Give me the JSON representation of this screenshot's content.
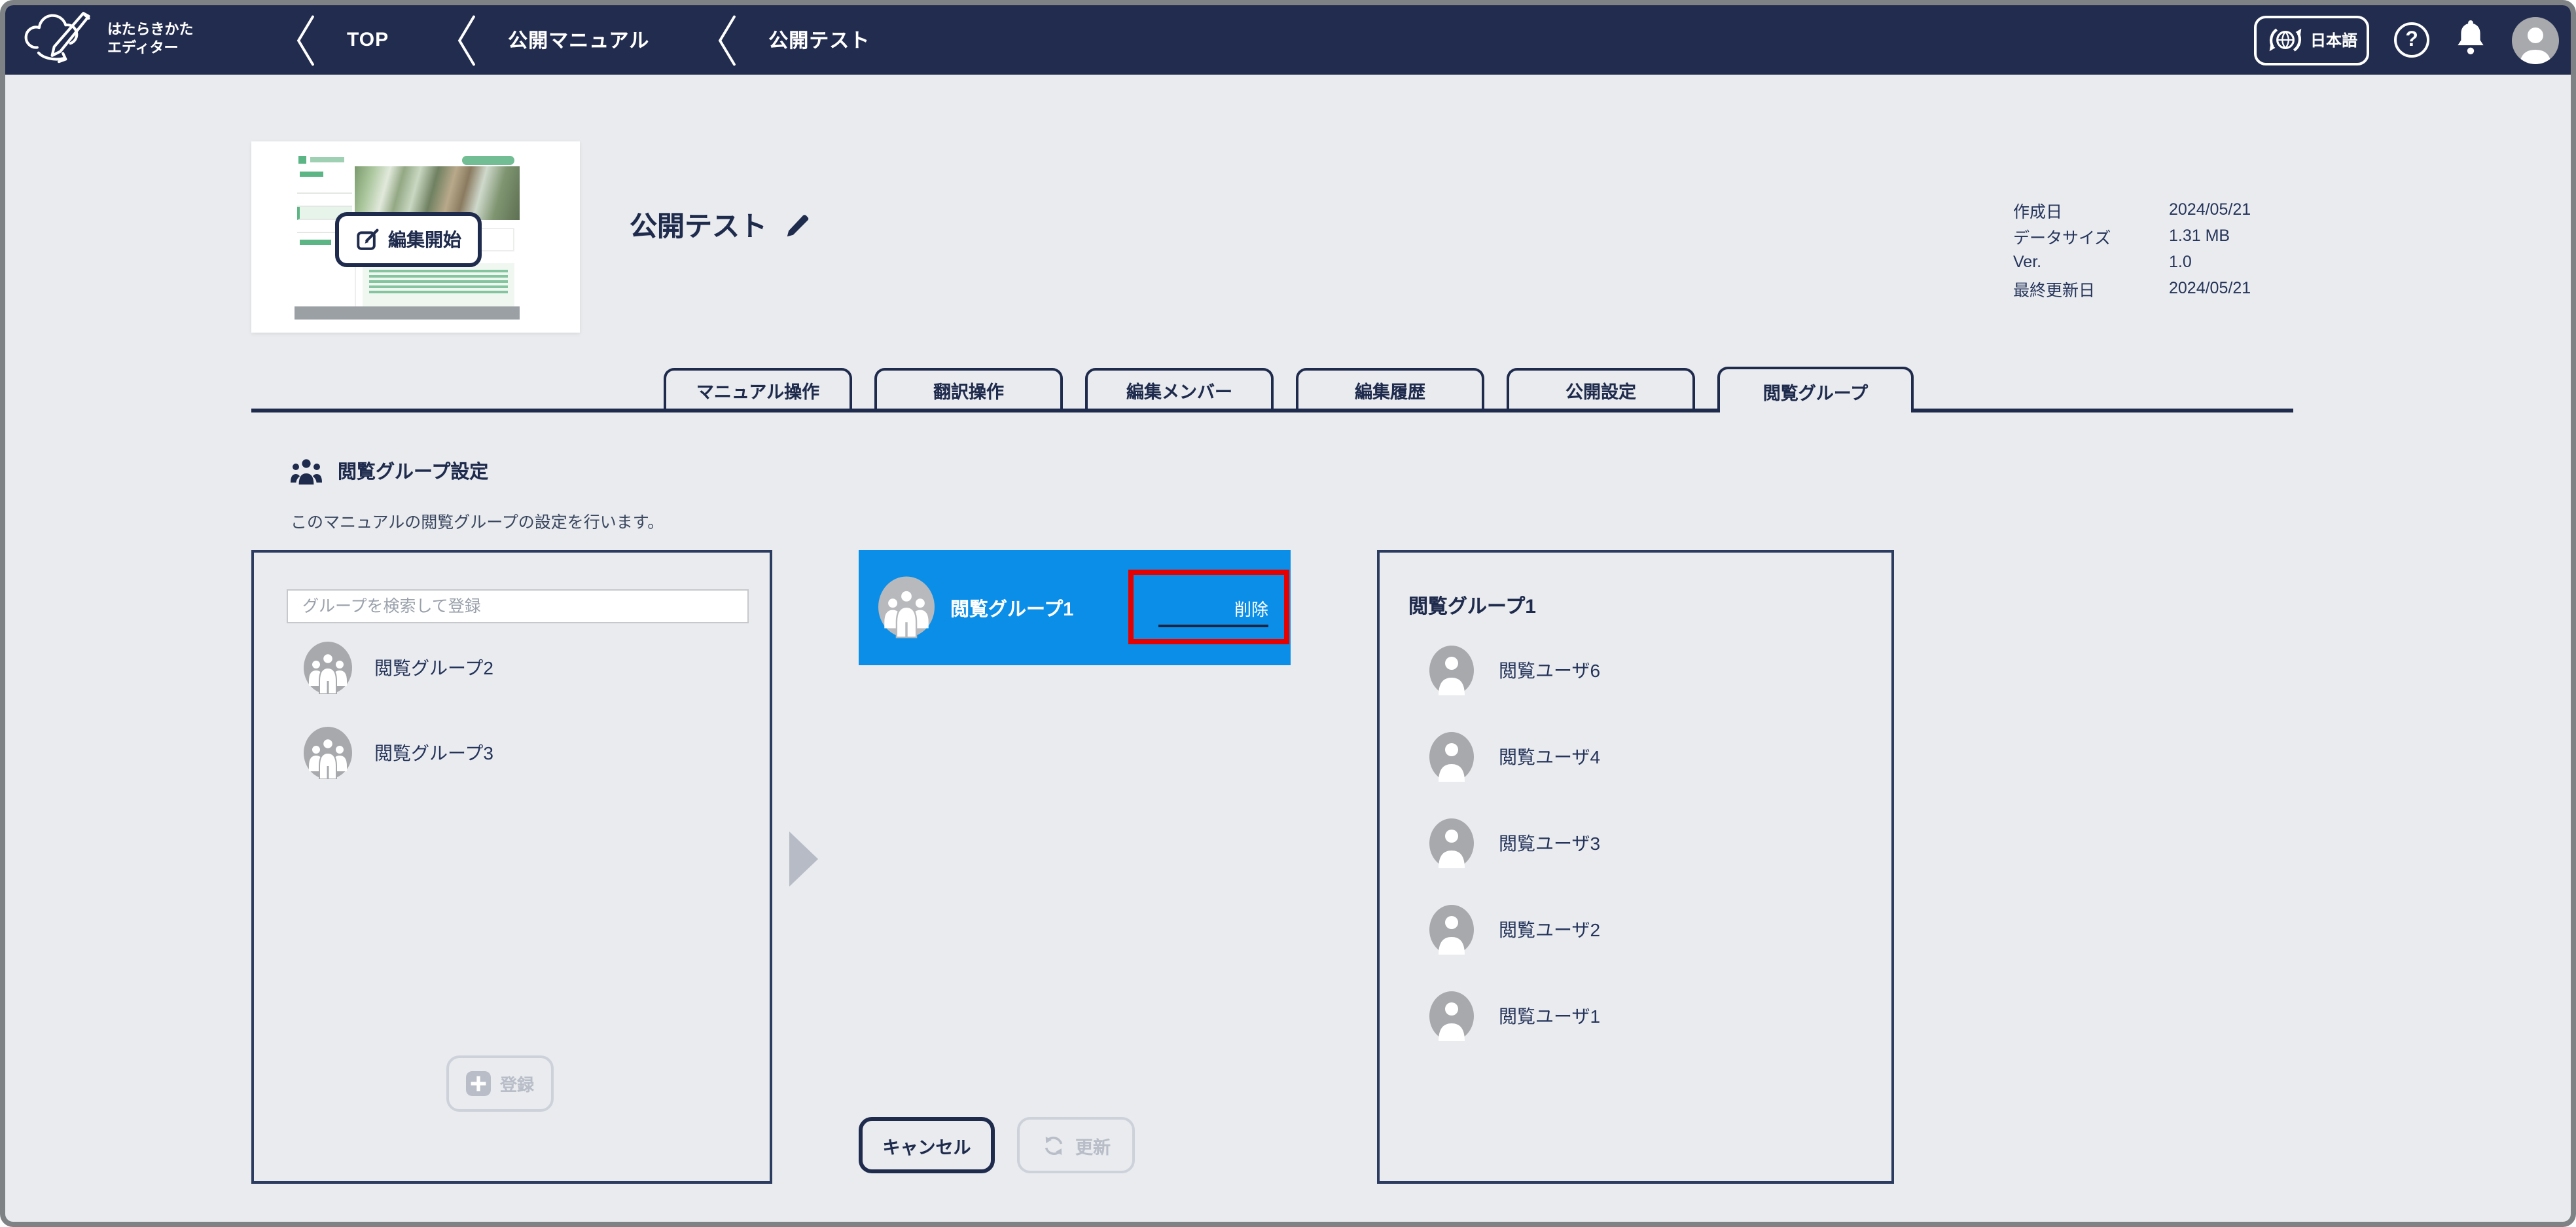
{
  "header": {
    "logo": {
      "line1": "はたらきかた",
      "line2": "エディター"
    },
    "breadcrumbs": [
      {
        "label": "TOP"
      },
      {
        "label": "公開マニュアル"
      },
      {
        "label": "公開テスト"
      }
    ],
    "language_button": {
      "label": "日本語"
    },
    "help_label": "?"
  },
  "manual": {
    "title": "公開テスト",
    "edit_start_label": "編集開始",
    "meta": [
      {
        "label": "作成日",
        "value": "2024/05/21"
      },
      {
        "label": "データサイズ",
        "value": "1.31 MB"
      },
      {
        "label": "Ver.",
        "value": "1.0"
      },
      {
        "label": "最終更新日",
        "value": "2024/05/21"
      }
    ]
  },
  "tabs": [
    {
      "label": "マニュアル操作"
    },
    {
      "label": "翻訳操作"
    },
    {
      "label": "編集メンバー"
    },
    {
      "label": "編集履歴"
    },
    {
      "label": "公開設定"
    },
    {
      "label": "閲覧グループ",
      "active": true
    }
  ],
  "section": {
    "title": "閲覧グループ設定",
    "description": "このマニュアルの閲覧グループの設定を行います。"
  },
  "group_picker": {
    "search_placeholder": "グループを検索して登録",
    "groups": [
      {
        "name": "閲覧グループ2"
      },
      {
        "name": "閲覧グループ3"
      }
    ],
    "register_label": "登録"
  },
  "selected_group": {
    "name": "閲覧グループ1",
    "delete_label": "削除"
  },
  "members_panel": {
    "title": "閲覧グループ1",
    "users": [
      {
        "name": "閲覧ユーザ6"
      },
      {
        "name": "閲覧ユーザ4"
      },
      {
        "name": "閲覧ユーザ3"
      },
      {
        "name": "閲覧ユーザ2"
      },
      {
        "name": "閲覧ユーザ1"
      }
    ]
  },
  "footer_actions": {
    "cancel": "キャンセル",
    "update": "更新"
  },
  "colors": {
    "header_navy": "#222c4e",
    "accent_blue": "#0a8ee8",
    "annotation_red": "#e60000",
    "page_bg": "#e9ebee"
  }
}
